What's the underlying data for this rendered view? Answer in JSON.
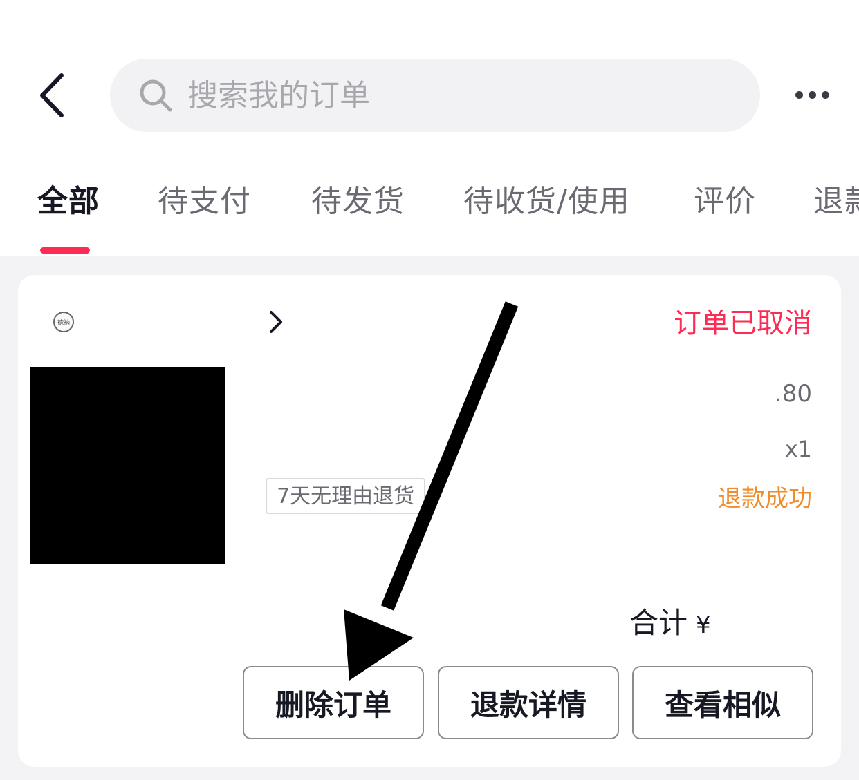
{
  "header": {
    "back_icon": "chevron-left-icon",
    "search": {
      "placeholder": "搜索我的订单",
      "value": "",
      "icon": "search-icon"
    },
    "more_icon": "more-horizontal-icon"
  },
  "tabs": [
    {
      "label": "全部",
      "active": true
    },
    {
      "label": "待支付",
      "active": false
    },
    {
      "label": "待发货",
      "active": false
    },
    {
      "label": "待收货/使用",
      "active": false
    },
    {
      "label": "评价",
      "active": false
    },
    {
      "label": "退款",
      "active": false
    }
  ],
  "order": {
    "shop_logo_text": "德衲",
    "status": "订单已取消",
    "price": ".80",
    "quantity": "x1",
    "return_policy_tag": "7天无理由退货",
    "refund_status": "退款成功",
    "total_label": "合计",
    "total_currency": "¥",
    "actions": {
      "delete": "删除订单",
      "refund_detail": "退款详情",
      "view_similar": "查看相似"
    }
  },
  "colors": {
    "accent": "#fe2c55",
    "refund_status": "#f08c2a",
    "background": "#f3f3f5",
    "text_primary": "#161823",
    "text_secondary": "#6a6b72"
  }
}
